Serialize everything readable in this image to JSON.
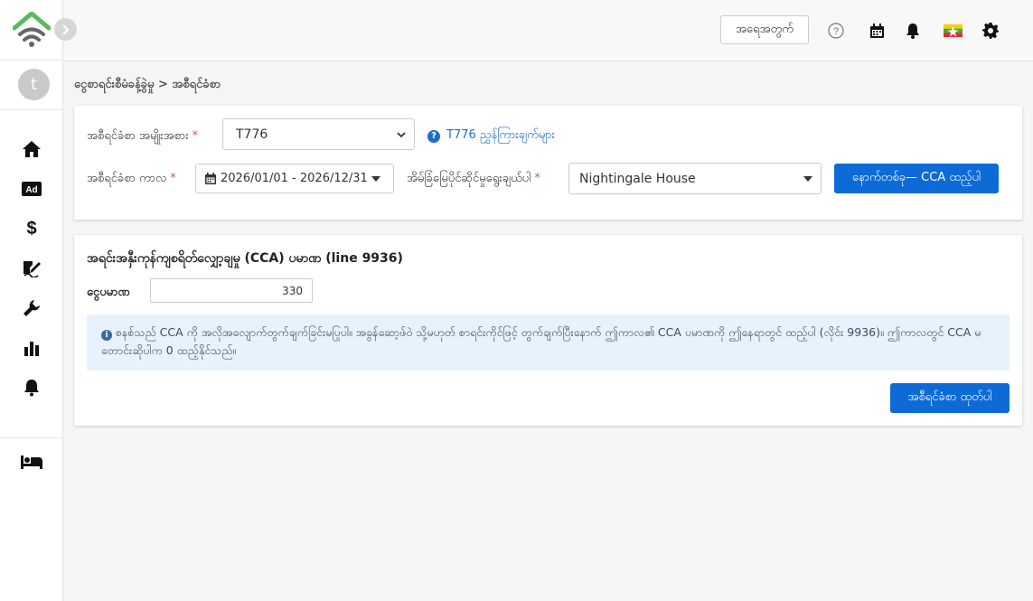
{
  "sidebar": {
    "avatar_letter": "t",
    "items": [
      {
        "icon": "home-icon"
      },
      {
        "icon": "ad-icon",
        "label": "Ad"
      },
      {
        "icon": "dollar-icon",
        "label": "$"
      },
      {
        "icon": "signature-icon"
      },
      {
        "icon": "wrench-icon"
      },
      {
        "icon": "bar-chart-icon"
      },
      {
        "icon": "bell-icon"
      },
      {
        "icon": "bed-icon"
      }
    ]
  },
  "header": {
    "logout_label": "အရေအတွက်",
    "icons": [
      "help-icon",
      "calendar-icon",
      "notification-bell-icon",
      "myanmar-flag-icon",
      "settings-gear-icon"
    ]
  },
  "breadcrumb": {
    "text": "ငွေစာရင်းစီမံခန့်ခွဲမှု > အစီရင်ခံစာ"
  },
  "filters": {
    "report_type_label": "အစီရင်ခံစာ အမျိုးအစား",
    "report_type_value": "T776",
    "help_link": "T776 ညွှန်ကြားချက်များ",
    "period_label": "အစီရင်ခံစာ ကာလ",
    "period_value": "2026/01/01 - 2026/12/31",
    "property_label": "အိမ်ခြံမြေပိုင်ဆိုင်မှုရွေးချယ်ပါ",
    "property_value": "Nightingale House",
    "next_button": "နောက်တစ်ခု— CCA ထည့်ပါ"
  },
  "cca": {
    "title": "အရင်းအနှီးကုန်ကျစရိတ်လျှော့ချမှု (CCA) ပမာဏ  (line 9936)",
    "amount_label": "ငွေပမာဏ",
    "amount_value": "330",
    "info_text": "စနစ်သည် CCA ကို အလိုအလျောက်တွက်ချက်ခြင်းမပြုပါ။ အခွန်ဆော့ဖ်ဝဲ သို့မဟုတ် စာရင်းကိုင်ဖြင့် တွက်ချက်ပြီးနောက် ဤကာလ၏ CCA ပမာဏကို ဤနေရာတွင် ထည့်ပါ (လိုင်း 9936)။ ဤကာလတွင် CCA မတောင်းဆိုပါက 0 ထည့်နိုင်သည်။",
    "print_button": "အစီရင်ခံစာ ထုတ်ပါ"
  },
  "colors": {
    "primary": "#0d6bd8",
    "logo_green": "#5cb85c",
    "logo_gray": "#555555",
    "required": "#d9534f",
    "info_bg": "#e8f2fc"
  }
}
